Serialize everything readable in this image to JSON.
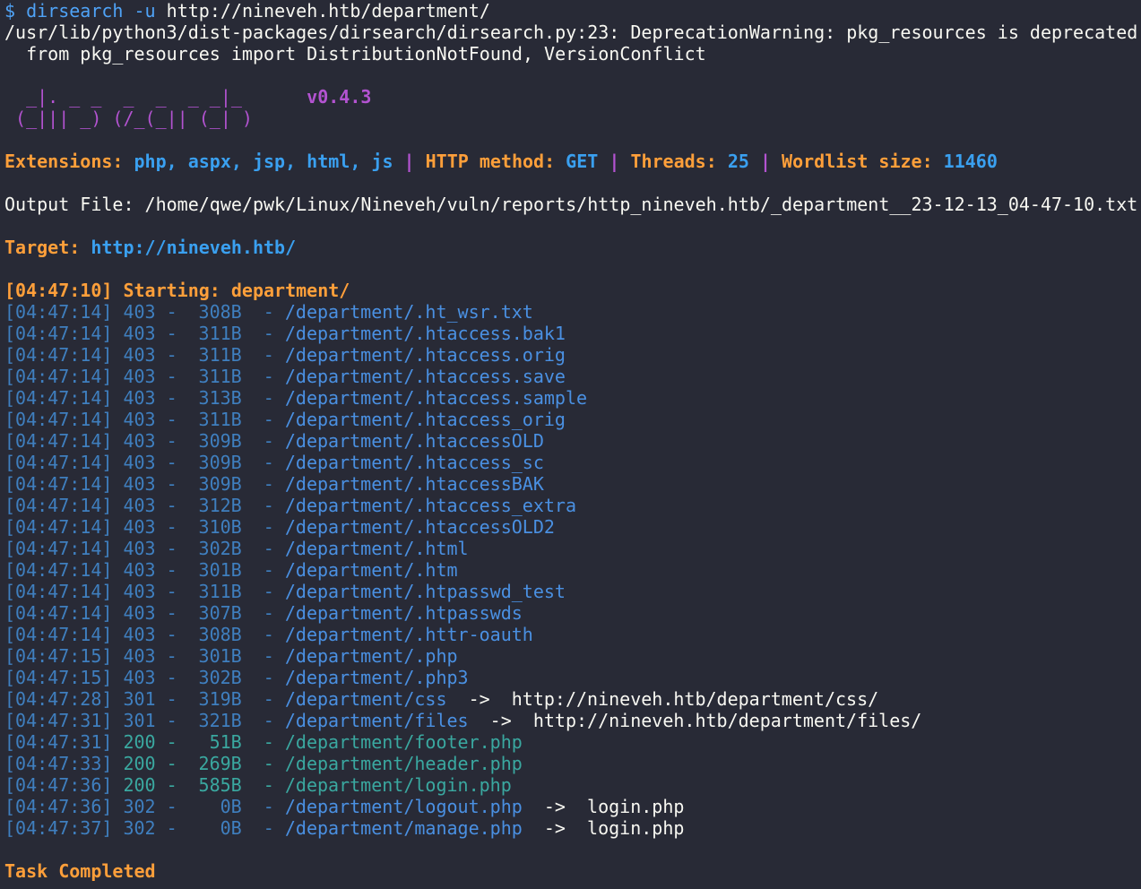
{
  "command": {
    "prompt": "$",
    "program": "dirsearch",
    "flag": "-u",
    "url": "http://nineveh.htb/department/"
  },
  "warning": {
    "line1": "/usr/lib/python3/dist-packages/dirsearch/dirsearch.py:23: DeprecationWarning: pkg_resources is deprecated",
    "line2": "  from pkg_resources import DistributionNotFound, VersionConflict"
  },
  "banner": {
    "ascii_line1": "  _|. _ _  _  _  _ _|_    ",
    "ascii_line2": " (_||| _) (/_(_|| (_| )   ",
    "version": "v0.4.3"
  },
  "config": {
    "extensions_label": "Extensions:",
    "extensions_value": "php, aspx, jsp, html, js",
    "method_label": "HTTP method:",
    "method_value": "GET",
    "threads_label": "Threads:",
    "threads_value": "25",
    "wordlist_label": "Wordlist size:",
    "wordlist_value": "11460",
    "separator": "|"
  },
  "output_file": "Output File: /home/qwe/pwk/Linux/Nineveh/vuln/reports/http_nineveh.htb/_department__23-12-13_04-47-10.txt",
  "target": {
    "label": "Target:",
    "url": "http://nineveh.htb/"
  },
  "starting": {
    "time": "[04:47:10]",
    "text": "Starting: department/"
  },
  "results": [
    {
      "time": "[04:47:14]",
      "code": "403",
      "size": "308B",
      "path": "/department/.ht_wsr.txt",
      "redirect": ""
    },
    {
      "time": "[04:47:14]",
      "code": "403",
      "size": "311B",
      "path": "/department/.htaccess.bak1",
      "redirect": ""
    },
    {
      "time": "[04:47:14]",
      "code": "403",
      "size": "311B",
      "path": "/department/.htaccess.orig",
      "redirect": ""
    },
    {
      "time": "[04:47:14]",
      "code": "403",
      "size": "311B",
      "path": "/department/.htaccess.save",
      "redirect": ""
    },
    {
      "time": "[04:47:14]",
      "code": "403",
      "size": "313B",
      "path": "/department/.htaccess.sample",
      "redirect": ""
    },
    {
      "time": "[04:47:14]",
      "code": "403",
      "size": "311B",
      "path": "/department/.htaccess_orig",
      "redirect": ""
    },
    {
      "time": "[04:47:14]",
      "code": "403",
      "size": "309B",
      "path": "/department/.htaccessOLD",
      "redirect": ""
    },
    {
      "time": "[04:47:14]",
      "code": "403",
      "size": "309B",
      "path": "/department/.htaccess_sc",
      "redirect": ""
    },
    {
      "time": "[04:47:14]",
      "code": "403",
      "size": "309B",
      "path": "/department/.htaccessBAK",
      "redirect": ""
    },
    {
      "time": "[04:47:14]",
      "code": "403",
      "size": "312B",
      "path": "/department/.htaccess_extra",
      "redirect": ""
    },
    {
      "time": "[04:47:14]",
      "code": "403",
      "size": "310B",
      "path": "/department/.htaccessOLD2",
      "redirect": ""
    },
    {
      "time": "[04:47:14]",
      "code": "403",
      "size": "302B",
      "path": "/department/.html",
      "redirect": ""
    },
    {
      "time": "[04:47:14]",
      "code": "403",
      "size": "301B",
      "path": "/department/.htm",
      "redirect": ""
    },
    {
      "time": "[04:47:14]",
      "code": "403",
      "size": "311B",
      "path": "/department/.htpasswd_test",
      "redirect": ""
    },
    {
      "time": "[04:47:14]",
      "code": "403",
      "size": "307B",
      "path": "/department/.htpasswds",
      "redirect": ""
    },
    {
      "time": "[04:47:14]",
      "code": "403",
      "size": "308B",
      "path": "/department/.httr-oauth",
      "redirect": ""
    },
    {
      "time": "[04:47:15]",
      "code": "403",
      "size": "301B",
      "path": "/department/.php",
      "redirect": ""
    },
    {
      "time": "[04:47:15]",
      "code": "403",
      "size": "302B",
      "path": "/department/.php3",
      "redirect": ""
    },
    {
      "time": "[04:47:28]",
      "code": "301",
      "size": "319B",
      "path": "/department/css",
      "redirect": "http://nineveh.htb/department/css/"
    },
    {
      "time": "[04:47:31]",
      "code": "301",
      "size": "321B",
      "path": "/department/files",
      "redirect": "http://nineveh.htb/department/files/"
    },
    {
      "time": "[04:47:31]",
      "code": "200",
      "size": "51B",
      "path": "/department/footer.php",
      "redirect": ""
    },
    {
      "time": "[04:47:33]",
      "code": "200",
      "size": "269B",
      "path": "/department/header.php",
      "redirect": ""
    },
    {
      "time": "[04:47:36]",
      "code": "200",
      "size": "585B",
      "path": "/department/login.php",
      "redirect": ""
    },
    {
      "time": "[04:47:36]",
      "code": "302",
      "size": "0B",
      "path": "/department/logout.php",
      "redirect": "login.php"
    },
    {
      "time": "[04:47:37]",
      "code": "302",
      "size": "0B",
      "path": "/department/manage.php",
      "redirect": "login.php"
    }
  ],
  "footer": {
    "task": "Task Completed"
  },
  "colors": {
    "background": "#282a36",
    "foreground": "#f8f8f2",
    "orange": "#ff9f3a",
    "blue": "#3aa0f0",
    "purple": "#b353d1",
    "teal": "#3aa8a0",
    "dim_blue": "#3f7fbf"
  }
}
